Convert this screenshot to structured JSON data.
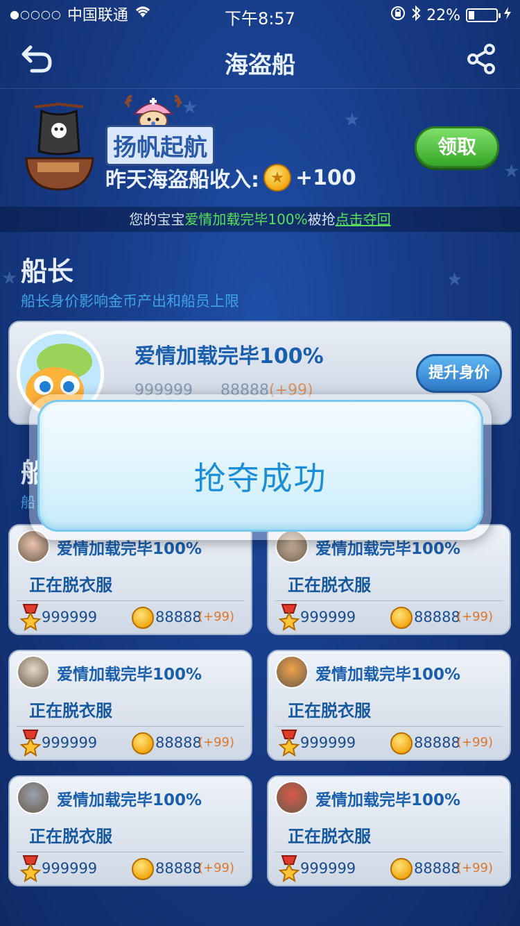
{
  "status_bar": {
    "signal": "●○○○○",
    "carrier": "中国联通",
    "time": "下午8:57",
    "battery_percent": "22%",
    "battery_level": 0.22
  },
  "nav": {
    "title": "海盗船"
  },
  "banner": {
    "sail_title": "扬帆起航",
    "income_label": "昨天海盗船收入:",
    "income_value": "+100",
    "claim_label": "领取"
  },
  "notice": {
    "prefix": "您的宝宝",
    "highlight": "爱情加载完毕100%",
    "middle": "被抢",
    "link": "点击夺回"
  },
  "captain": {
    "title": "船长",
    "subtitle": "船长身价影响金币产出和船员上限",
    "name": "爱情加载完毕100%",
    "raise_label": "提升身价",
    "rank": "999999",
    "gold": "88888",
    "bonus": "(+99)"
  },
  "section2": {
    "title": "船",
    "subtitle": "船"
  },
  "crew": [
    {
      "name": "爱情加载完毕100%",
      "status": "正在脱衣服",
      "rank": "999999",
      "gold": "88888",
      "bonus": "(+99)"
    },
    {
      "name": "爱情加载完毕100%",
      "status": "正在脱衣服",
      "rank": "999999",
      "gold": "88888",
      "bonus": "(+99)"
    },
    {
      "name": "爱情加载完毕100%",
      "status": "正在脱衣服",
      "rank": "999999",
      "gold": "88888",
      "bonus": "(+99)"
    },
    {
      "name": "爱情加载完毕100%",
      "status": "正在脱衣服",
      "rank": "999999",
      "gold": "88888",
      "bonus": "(+99)"
    },
    {
      "name": "爱情加载完毕100%",
      "status": "正在脱衣服",
      "rank": "999999",
      "gold": "88888",
      "bonus": "(+99)"
    },
    {
      "name": "爱情加载完毕100%",
      "status": "正在脱衣服",
      "rank": "999999",
      "gold": "88888",
      "bonus": "(+99)"
    }
  ],
  "modal": {
    "message": "抢夺成功"
  },
  "colors": {
    "background": "#173b86",
    "accent_green": "#58e05a",
    "accent_blue": "#1a8ed8",
    "bonus_orange": "#e0762a"
  }
}
